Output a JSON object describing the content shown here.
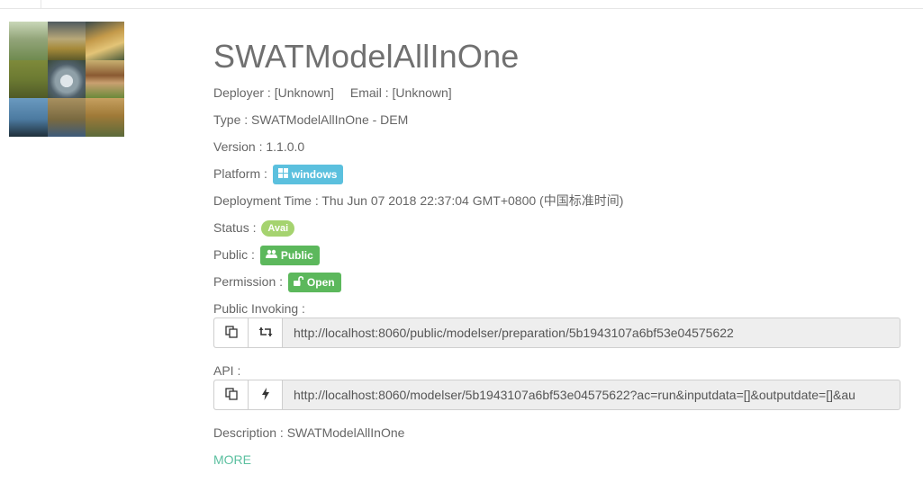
{
  "model": {
    "title": "SWATModelAllInOne",
    "deployer_label": "Deployer : ",
    "deployer_value": "[Unknown]",
    "email_label": "Email : ",
    "email_value": "[Unknown]",
    "type_label": "Type : ",
    "type_value": "SWATModelAllInOne - DEM",
    "version_label": "Version : ",
    "version_value": "1.1.0.0",
    "platform_label": "Platform : ",
    "platform_badge": "windows",
    "deployment_time_label": "Deployment Time : ",
    "deployment_time_value": "Thu Jun 07 2018 22:37:04 GMT+0800 (中国标准时间)",
    "status_label": "Status : ",
    "status_value": "Avai",
    "public_label": "Public : ",
    "public_badge": "Public",
    "permission_label": "Permission : ",
    "permission_badge": "Open",
    "public_invoking_label": "Public Invoking :",
    "public_invoking_url": "http://localhost:8060/public/modelser/preparation/5b1943107a6bf53e04575622",
    "api_label": "API :",
    "api_url": "http://localhost:8060/modelser/5b1943107a6bf53e04575622?ac=run&inputdata=[]&outputdate=[]&au",
    "description_label": "Description : ",
    "description_value": "SWATModelAllInOne",
    "more_link": "MORE"
  },
  "colors": {
    "info_badge": "#5bc0de",
    "success_badge": "#5cb85c",
    "status_pill": "#a5d36f",
    "more_link": "#5cc0a0"
  },
  "icons": {
    "platform": "windows-icon",
    "public": "users-icon",
    "permission": "unlock-icon",
    "copy": "copy-icon",
    "refresh": "retweet-icon",
    "api": "bolt-icon"
  }
}
